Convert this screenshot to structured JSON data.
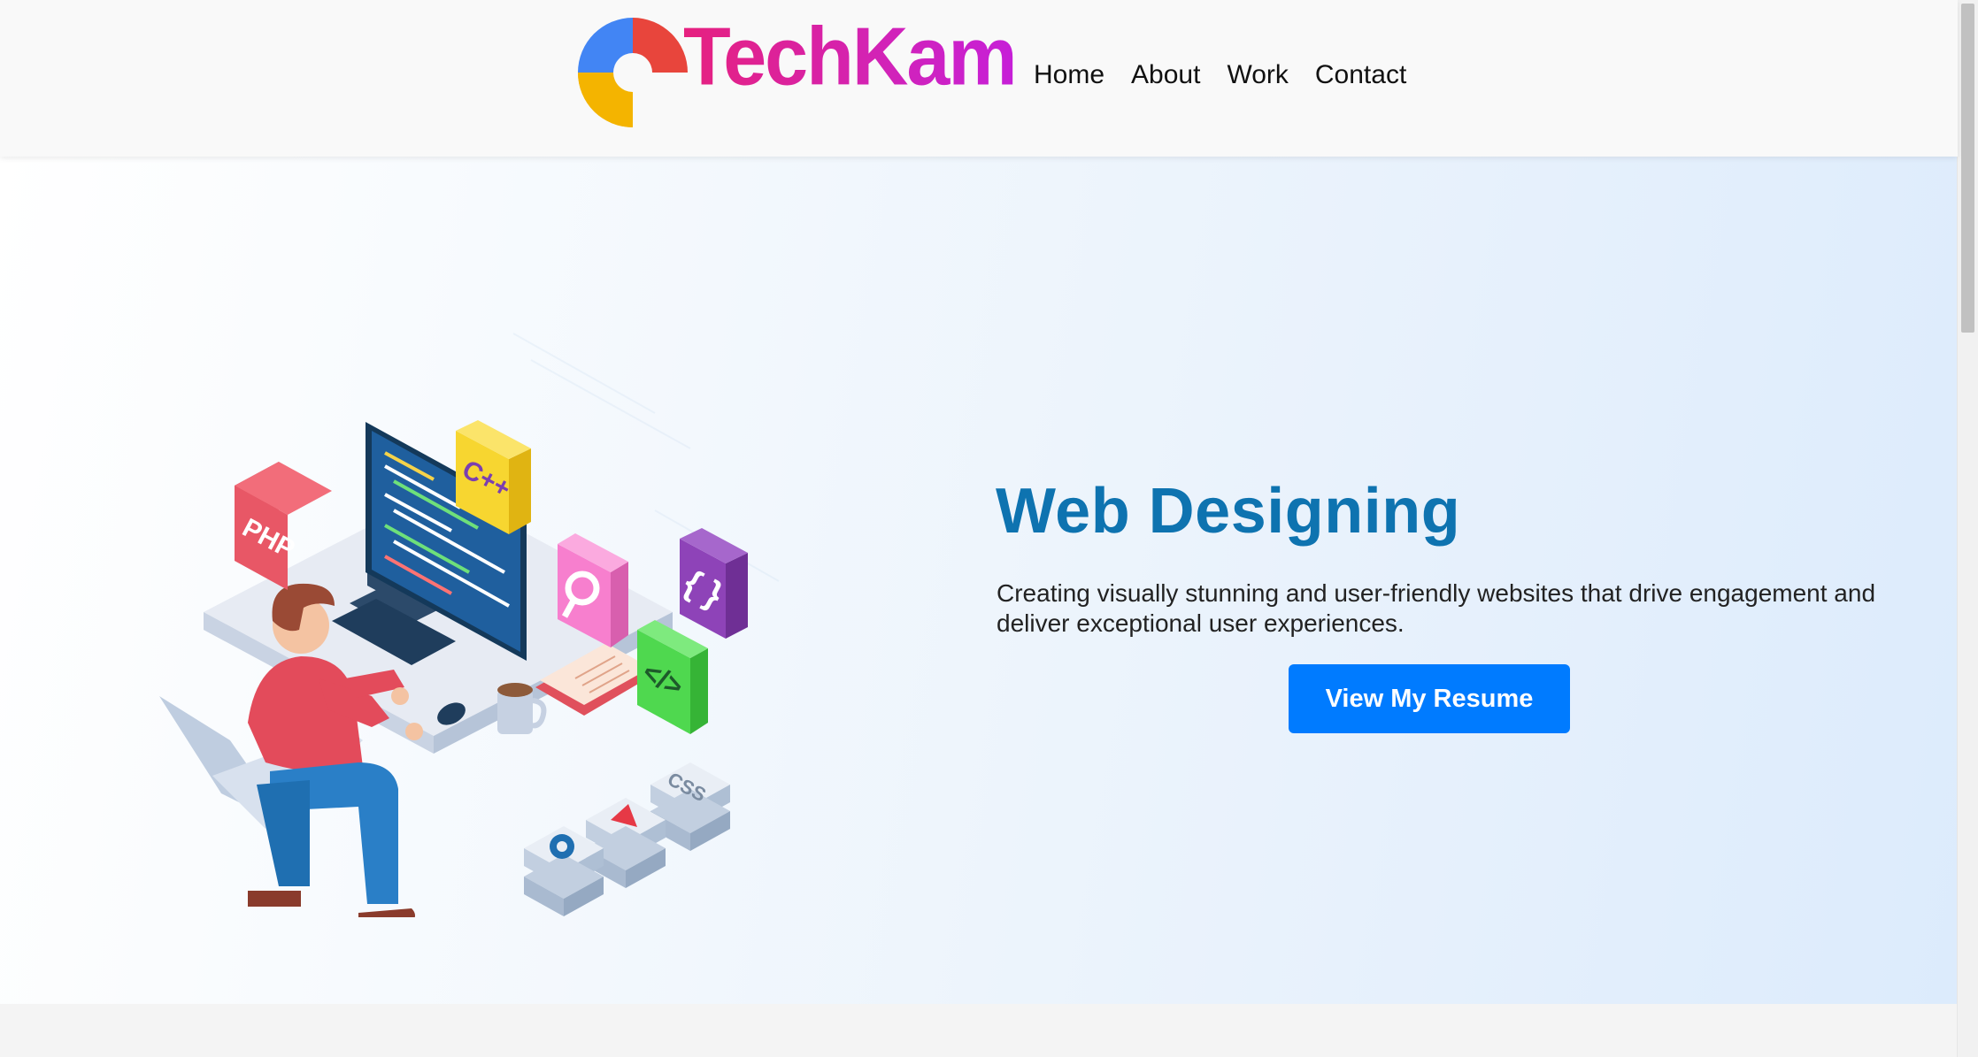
{
  "brand": {
    "name": "TechKam"
  },
  "nav": {
    "items": [
      {
        "label": "Home"
      },
      {
        "label": "About"
      },
      {
        "label": "Work"
      },
      {
        "label": "Contact"
      }
    ]
  },
  "hero": {
    "title": "Web Designing",
    "description": "Creating visually stunning and user-friendly websites that drive engagement and deliver exceptional user experiences.",
    "button_label": "View My Resume"
  },
  "illustration": {
    "tiles": [
      "PHP",
      "C++",
      "{ }",
      "</>",
      "CSS"
    ]
  },
  "colors": {
    "accent": "#007bff",
    "title": "#0e73b0",
    "brand_gradient_start": "#e6217f",
    "brand_gradient_end": "#c61fd8"
  }
}
